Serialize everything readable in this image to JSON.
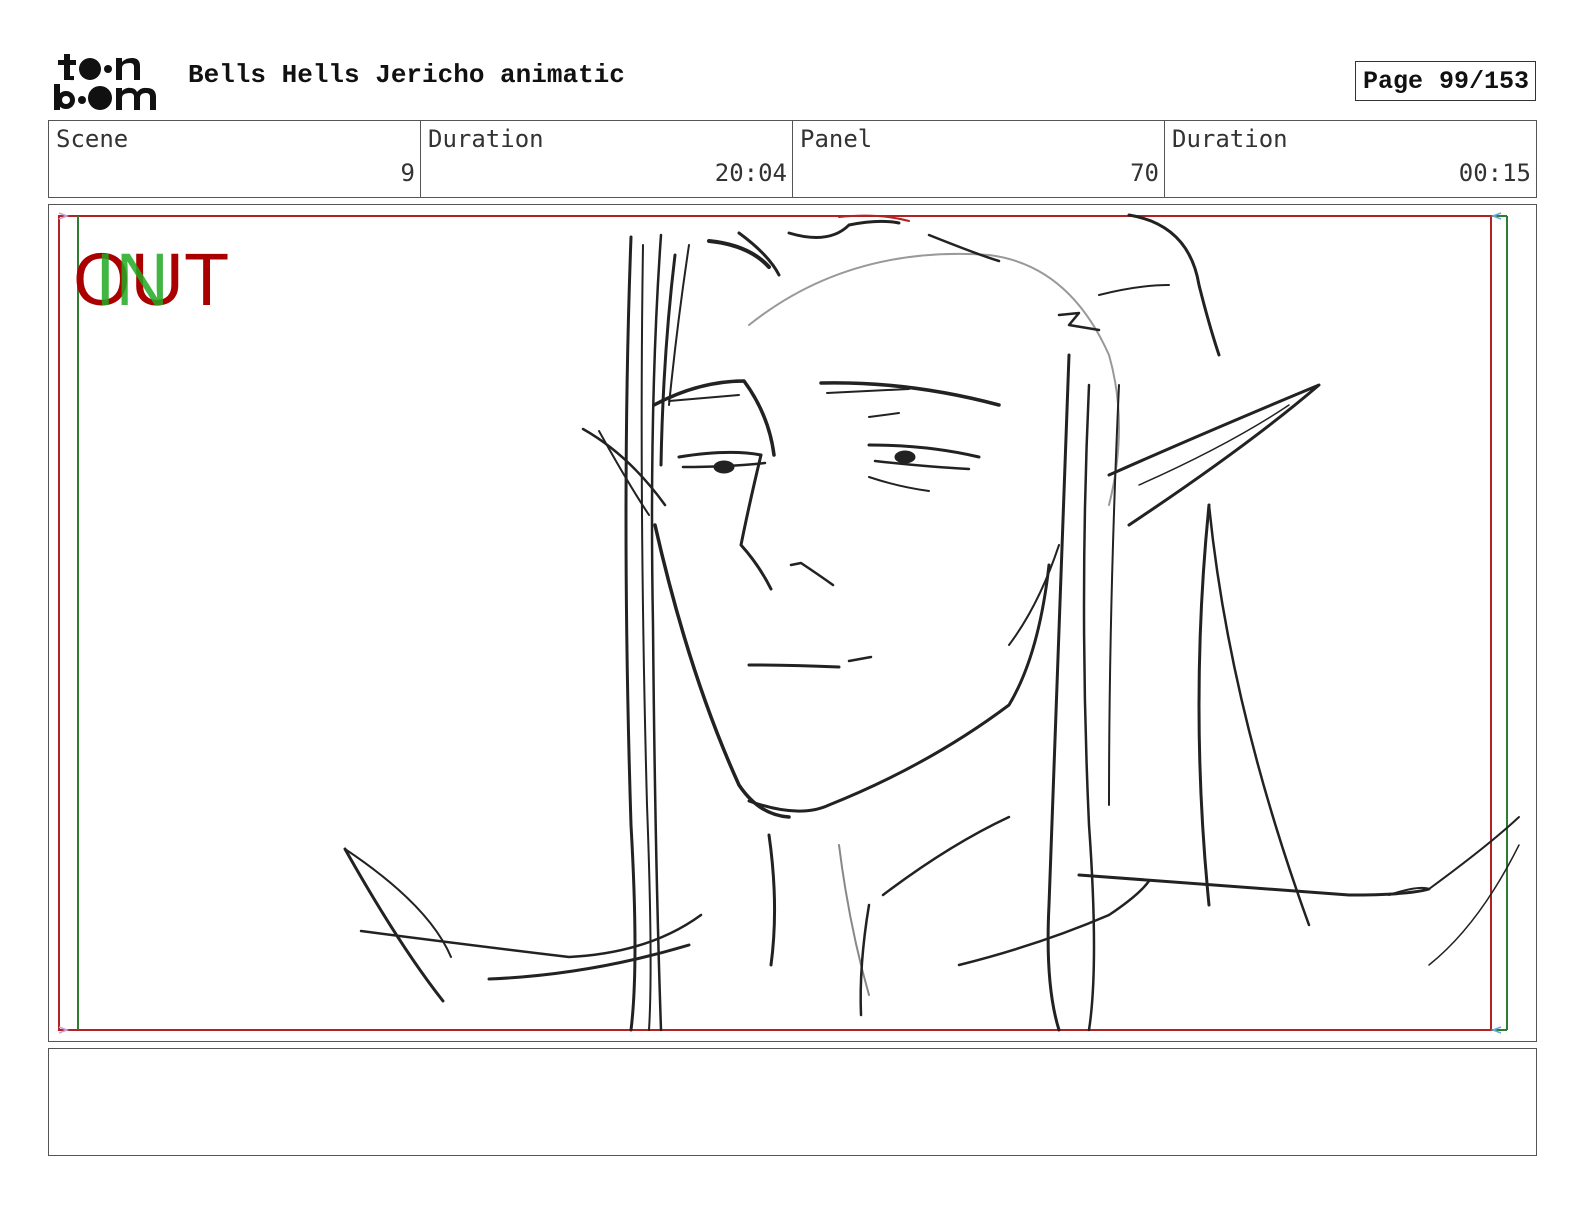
{
  "header": {
    "logo_label": "toon boom",
    "document_title": "Bells Hells Jericho animatic",
    "page_label": "Page",
    "page_number": "99/153"
  },
  "info_row": [
    {
      "label": "Scene",
      "value": "9"
    },
    {
      "label": "Duration",
      "value": "20:04"
    },
    {
      "label": "Panel",
      "value": "70"
    },
    {
      "label": "Duration",
      "value": "00:15"
    }
  ],
  "panel": {
    "out_marker": "OUT",
    "in_marker": "IN",
    "colors": {
      "out_frame": "#b22222",
      "in_frame": "#2e7d32",
      "out_text": "#aa0000",
      "in_text": "#22aa22",
      "sketch": "#222222"
    }
  },
  "notes": {
    "text": ""
  }
}
